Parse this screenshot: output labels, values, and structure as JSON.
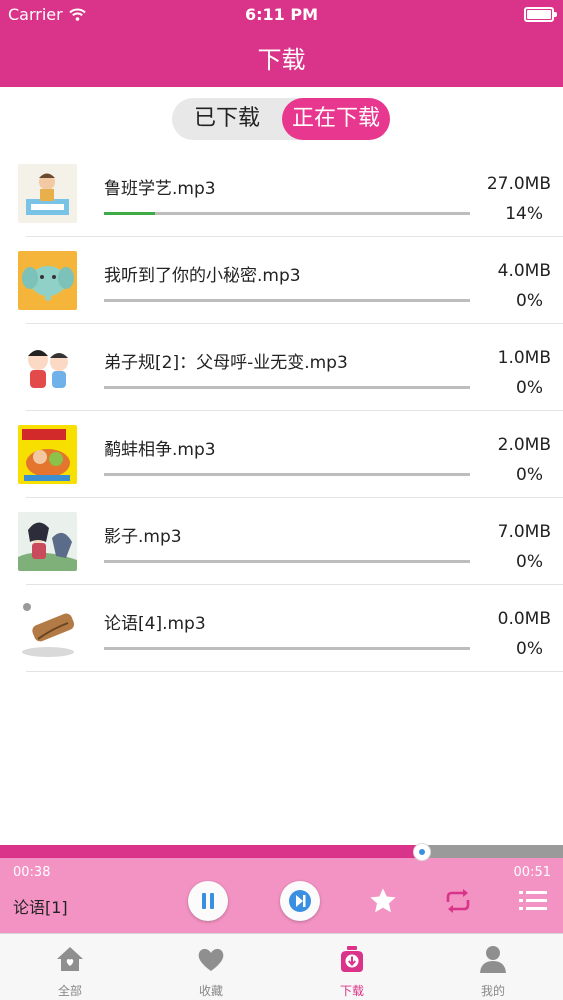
{
  "status_bar": {
    "carrier": "Carrier",
    "time": "6:11 PM"
  },
  "nav": {
    "title": "下载"
  },
  "segments": {
    "downloaded": "已下载",
    "downloading": "正在下载",
    "selected": "downloading"
  },
  "colors": {
    "brand": "#d9348a",
    "progress": "#3fab45",
    "player_bg": "#f393c3",
    "seek_thumb": "#3a8fe0"
  },
  "downloads": [
    {
      "title": "鲁班学艺.mp3",
      "size": "27.0MB",
      "percent": "14%",
      "progress": 0.14,
      "thumbnail": "luban-cover"
    },
    {
      "title": "我听到了你的小秘密.mp3",
      "size": "4.0MB",
      "percent": "0%",
      "progress": 0,
      "thumbnail": "elephant-cover"
    },
    {
      "title": "弟子规[2]：父母呼-业无变.mp3",
      "size": "1.0MB",
      "percent": "0%",
      "progress": 0,
      "thumbnail": "dizigui-cover"
    },
    {
      "title": "鹬蚌相争.mp3",
      "size": "2.0MB",
      "percent": "0%",
      "progress": 0,
      "thumbnail": "story-cover"
    },
    {
      "title": "影子.mp3",
      "size": "7.0MB",
      "percent": "0%",
      "progress": 0,
      "thumbnail": "shadow-cover"
    },
    {
      "title": "论语[4].mp3",
      "size": "0.0MB",
      "percent": "0%",
      "progress": 0,
      "thumbnail": "lunyu-cover"
    }
  ],
  "player": {
    "current_time": "00:38",
    "total_time": "00:51",
    "track": "论语[1]",
    "position": 0.75,
    "icons": [
      "pause-icon",
      "next-icon",
      "star-icon",
      "repeat-icon",
      "playlist-icon"
    ]
  },
  "tabs": [
    {
      "label": "全部",
      "icon": "home-icon"
    },
    {
      "label": "收藏",
      "icon": "heart-icon"
    },
    {
      "label": "下载",
      "icon": "download-icon",
      "active": true
    },
    {
      "label": "我的",
      "icon": "user-icon"
    }
  ]
}
